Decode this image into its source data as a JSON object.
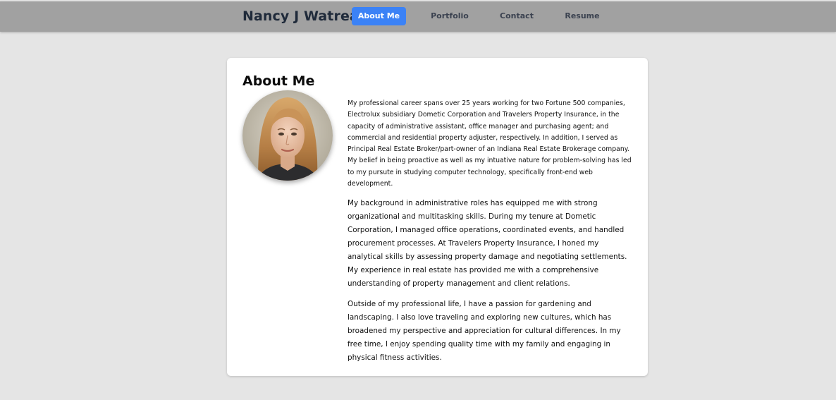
{
  "header": {
    "site_name": "Nancy J Watreas",
    "nav": [
      {
        "label": "About Me",
        "active": true
      },
      {
        "label": "Portfolio",
        "active": false
      },
      {
        "label": "Contact",
        "active": false
      },
      {
        "label": "Resume",
        "active": false
      }
    ]
  },
  "about": {
    "title": "About Me",
    "photo_icon": "profile-photo",
    "paragraphs": [
      "My professional career spans over 25 years working for two Fortune 500 companies, Electrolux subsidiary Dometic Corporation and Travelers Property Insurance, in the capacity of administrative assistant, office manager and purchasing agent; and commercial and residential property adjuster, respectively. In addition, I served as Principal Real Estate Broker/part-owner of an Indiana Real Estate Brokerage company. My belief in being proactive as well as my intuative nature for problem-solving has led to my pursute in studying computer technology, specifically front-end web development.",
      "My background in administrative roles has equipped me with strong organizational and multitasking skills. During my tenure at Dometic Corporation, I managed office operations, coordinated events, and handled procurement processes. At Travelers Property Insurance, I honed my analytical skills by assessing property damage and negotiating settlements. My experience in real estate has provided me with a comprehensive understanding of property management and client relations.",
      "Outside of my professional life, I have a passion for gardening and landscaping. I also love traveling and exploring new cultures, which has broadened my perspective and appreciation for cultural differences. In my free time, I enjoy spending quality time with my family and engaging in physical fitness activities."
    ]
  },
  "colors": {
    "page_bg": "#e5e5e5",
    "header_bg": "#a1a1a1",
    "accent": "#3b82f6",
    "card_bg": "#ffffff",
    "heading": "#1f2a3a"
  }
}
